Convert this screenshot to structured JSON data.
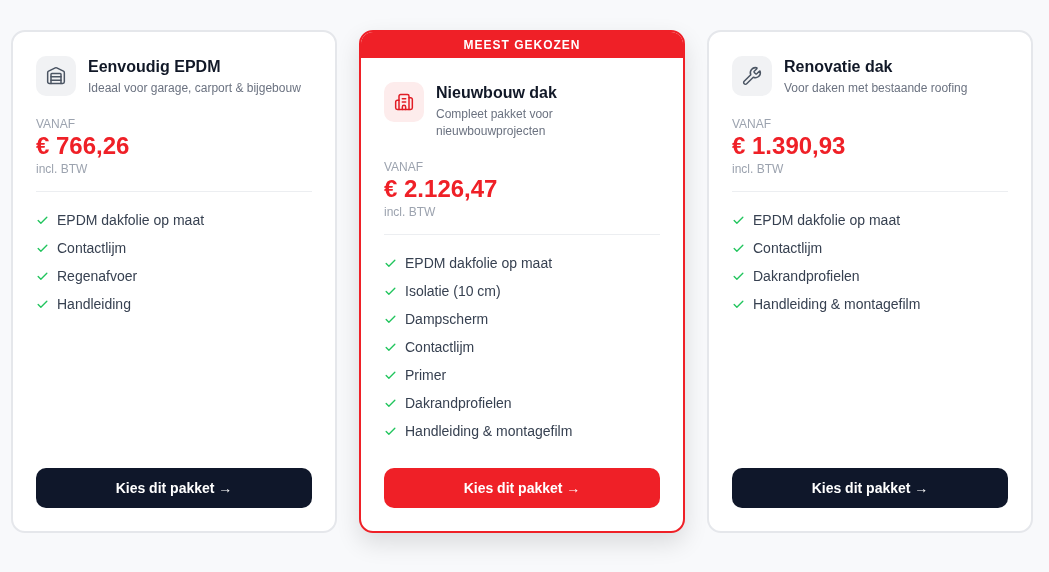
{
  "plans": [
    {
      "featured": false,
      "title": "Eenvoudig EPDM",
      "subtitle": "Ideaal voor garage, carport & bijgebouw",
      "price_label": "VANAF",
      "price": "€ 766,26",
      "tax_note": "incl. BTW",
      "features": [
        "EPDM dakfolie op maat",
        "Contactlijm",
        "Regenafvoer",
        "Handleiding"
      ],
      "button": "Kies dit pakket →"
    },
    {
      "featured": true,
      "badge": "MEEST GEKOZEN",
      "title": "Nieuwbouw dak",
      "subtitle": "Compleet pakket voor nieuwbouwprojecten",
      "price_label": "VANAF",
      "price": "€ 2.126,47",
      "tax_note": "incl. BTW",
      "features": [
        "EPDM dakfolie op maat",
        "Isolatie (10 cm)",
        "Dampscherm",
        "Contactlijm",
        "Primer",
        "Dakrandprofielen",
        "Handleiding & montagefilm"
      ],
      "button": "Kies dit pakket →"
    },
    {
      "featured": false,
      "title": "Renovatie dak",
      "subtitle": "Voor daken met bestaande roofing",
      "price_label": "VANAF",
      "price": "€ 1.390,93",
      "tax_note": "incl. BTW",
      "features": [
        "EPDM dakfolie op maat",
        "Contactlijm",
        "Dakrandprofielen",
        "Handleiding & montagefilm"
      ],
      "button": "Kies dit pakket →"
    }
  ]
}
